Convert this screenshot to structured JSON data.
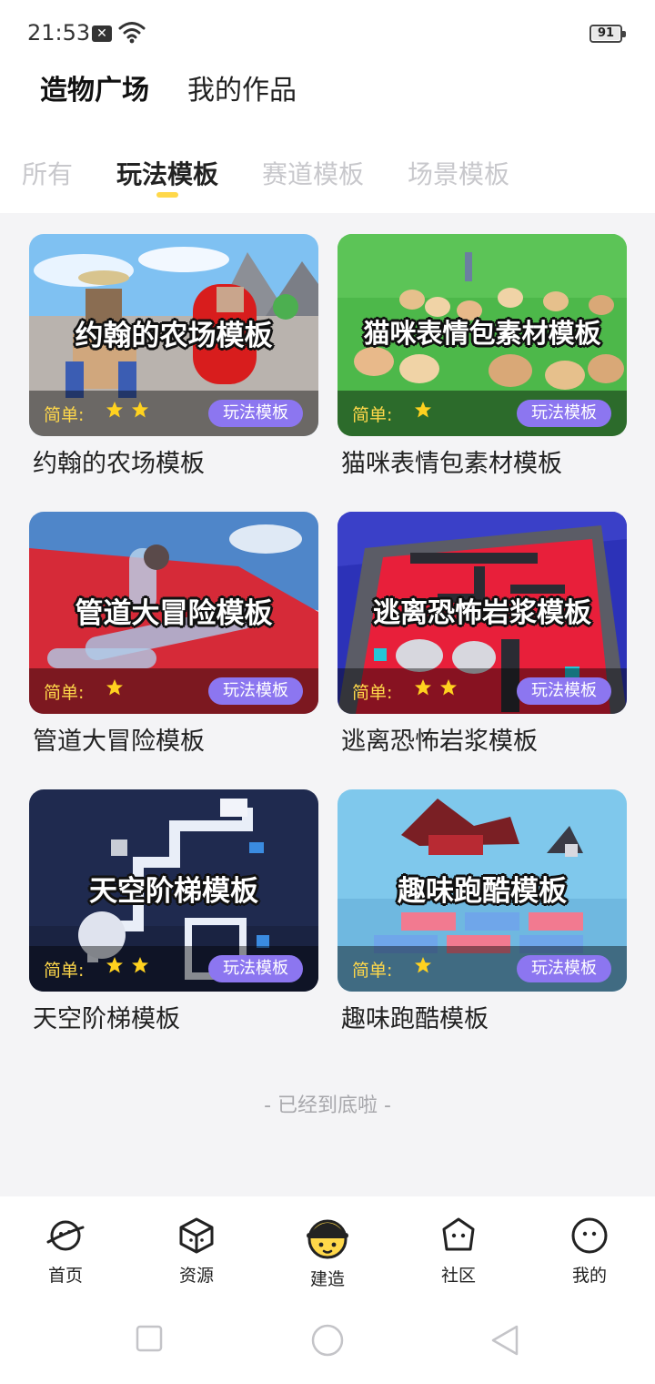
{
  "status_bar": {
    "time": "21:53",
    "sim_badge": "✕",
    "battery": "91"
  },
  "header": {
    "tabs": [
      "造物广场",
      "我的作品"
    ],
    "active_tab": "造物广场"
  },
  "categories": {
    "items": [
      "所有",
      "玩法模板",
      "赛道模板",
      "场景模板"
    ],
    "active": "玩法模板"
  },
  "cards": [
    {
      "title_overlay": "约翰的农场模板",
      "name": "约翰的农场模板",
      "difficulty_label": "简单:",
      "stars": 2,
      "tag": "玩法模板"
    },
    {
      "title_overlay": "猫咪表情包素材模板",
      "name": "猫咪表情包素材模板",
      "difficulty_label": "简单:",
      "stars": 1,
      "tag": "玩法模板"
    },
    {
      "title_overlay": "管道大冒险模板",
      "name": "管道大冒险模板",
      "difficulty_label": "简单:",
      "stars": 1,
      "tag": "玩法模板"
    },
    {
      "title_overlay": "逃离恐怖岩浆模板",
      "name": "逃离恐怖岩浆模板",
      "difficulty_label": "简单:",
      "stars": 2,
      "tag": "玩法模板"
    },
    {
      "title_overlay": "天空阶梯模板",
      "name": "天空阶梯模板",
      "difficulty_label": "简单:",
      "stars": 2,
      "tag": "玩法模板"
    },
    {
      "title_overlay": "趣味跑酷模板",
      "name": "趣味跑酷模板",
      "difficulty_label": "简单:",
      "stars": 1,
      "tag": "玩法模板"
    }
  ],
  "end_text": "- 已经到底啦 -",
  "bottom_nav": {
    "items": [
      {
        "label": "首页",
        "icon": "planet-icon"
      },
      {
        "label": "资源",
        "icon": "cube-icon"
      },
      {
        "label": "建造",
        "icon": "hardhat-face-icon"
      },
      {
        "label": "社区",
        "icon": "blob-face-icon"
      },
      {
        "label": "我的",
        "icon": "face-icon"
      }
    ],
    "active": "建造"
  },
  "colors": {
    "accent_yellow": "#ffd84a",
    "tag_purple": "#8c76f0",
    "background": "#f4f4f6"
  }
}
